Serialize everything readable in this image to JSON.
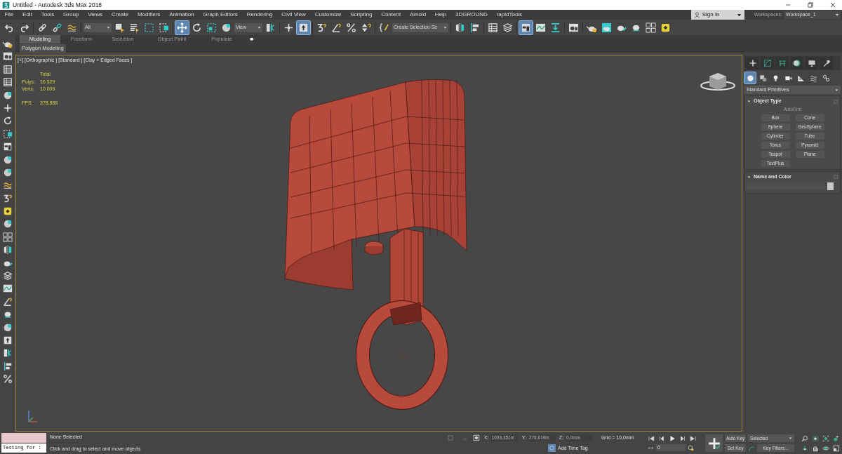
{
  "window": {
    "title": "Untitled - Autodesk 3ds Max 2018"
  },
  "menu": [
    "File",
    "Edit",
    "Tools",
    "Group",
    "Views",
    "Create",
    "Modifiers",
    "Animation",
    "Graph Editors",
    "Rendering",
    "Civil View",
    "Customize",
    "Scripting",
    "Content",
    "Arnold",
    "Help",
    "3DGROUND",
    "rapidTools"
  ],
  "account": {
    "label": "Sign In"
  },
  "workspaces": {
    "label": "Workspaces:",
    "value": "Workspace_1"
  },
  "main_toolbar": [
    {
      "kind": "button",
      "selected": false
    },
    {
      "kind": "button",
      "selected": false
    },
    {
      "kind": "sep"
    },
    {
      "kind": "button",
      "selected": false
    },
    {
      "kind": "button",
      "selected": false
    },
    {
      "kind": "button",
      "selected": false
    },
    {
      "kind": "sep"
    },
    {
      "kind": "dropdown",
      "value": "All"
    },
    {
      "kind": "button",
      "selected": false
    },
    {
      "kind": "button",
      "selected": false
    },
    {
      "kind": "button",
      "selected": false
    },
    {
      "kind": "button",
      "selected": false
    },
    {
      "kind": "sep"
    },
    {
      "kind": "button",
      "selected": true
    },
    {
      "kind": "button",
      "selected": false
    },
    {
      "kind": "button",
      "selected": false
    },
    {
      "kind": "button",
      "selected": false
    },
    {
      "kind": "dropdown",
      "value": "View"
    },
    {
      "kind": "button",
      "selected": false
    },
    {
      "kind": "sep"
    },
    {
      "kind": "button",
      "selected": false
    },
    {
      "kind": "button",
      "selected": true
    },
    {
      "kind": "sep"
    },
    {
      "kind": "button",
      "selected": false
    },
    {
      "kind": "button",
      "selected": false
    },
    {
      "kind": "button",
      "selected": false
    },
    {
      "kind": "button",
      "selected": false
    },
    {
      "kind": "sep"
    },
    {
      "kind": "button",
      "selected": false
    },
    {
      "kind": "dropdown",
      "value": "Create Selection Se"
    },
    {
      "kind": "sep"
    },
    {
      "kind": "button",
      "selected": false
    },
    {
      "kind": "button",
      "selected": false
    },
    {
      "kind": "sep"
    },
    {
      "kind": "button",
      "selected": false
    },
    {
      "kind": "button",
      "selected": false
    },
    {
      "kind": "sep"
    },
    {
      "kind": "button",
      "selected": true
    },
    {
      "kind": "button",
      "selected": false
    },
    {
      "kind": "button",
      "selected": false
    },
    {
      "kind": "sep"
    },
    {
      "kind": "button",
      "selected": false
    },
    {
      "kind": "sep"
    },
    {
      "kind": "button",
      "selected": false
    },
    {
      "kind": "button",
      "selected": false
    },
    {
      "kind": "button",
      "selected": false
    },
    {
      "kind": "button",
      "selected": false
    },
    {
      "kind": "button",
      "selected": false
    },
    {
      "kind": "button",
      "selected": false
    }
  ],
  "ribbon": {
    "tabs": [
      {
        "label": "Modeling",
        "selected": true
      },
      {
        "label": "Freeform",
        "selected": false
      },
      {
        "label": "Selection",
        "selected": false
      },
      {
        "label": "Object Paint",
        "selected": false
      },
      {
        "label": "Populate",
        "selected": false
      }
    ],
    "panel": "Polygon Modeling"
  },
  "viewport": {
    "label": "[+] [Orthographic ] [Standard ] [Clay + Edged Faces ]",
    "stats": {
      "header": "Total",
      "rows": [
        {
          "label": "Polys:",
          "value": "16 529"
        },
        {
          "label": "Verts:",
          "value": "10 009"
        }
      ],
      "fps_label": "FPS:",
      "fps_value": "378,888"
    }
  },
  "command_panel": {
    "categories": [
      {
        "selected": true
      },
      {
        "selected": false
      },
      {
        "selected": false
      },
      {
        "selected": false
      },
      {
        "selected": false
      },
      {
        "selected": false
      },
      {
        "selected": false
      }
    ],
    "dropdown": "Standard Primitives",
    "object_type": {
      "title": "Object Type",
      "autogrid": {
        "label": "AutoGrid",
        "disabled": true
      },
      "buttons": [
        "Box",
        "Cone",
        "Sphere",
        "GeoSphere",
        "Cylinder",
        "Tube",
        "Torus",
        "Pyramid",
        "Teapot",
        "Plane",
        "TextPlus"
      ]
    },
    "name_and_color": {
      "title": "Name and Color"
    }
  },
  "status": {
    "listener_text": "Testing for :",
    "selection": "None Selected",
    "prompt": "Click and drag to select and move objects",
    "coords": [
      {
        "label": "X:",
        "value": "1033,351m"
      },
      {
        "label": "Y:",
        "value": "276,619m"
      },
      {
        "label": "Z:",
        "value": "0,0mm"
      }
    ],
    "grid": "Grid = 10,0mm",
    "time_tag": "Add Time Tag",
    "frame": "0",
    "auto_key": "Auto Key",
    "set_key": "Set Key",
    "key_mode": "Selected",
    "key_filters": "Key Filters..."
  }
}
